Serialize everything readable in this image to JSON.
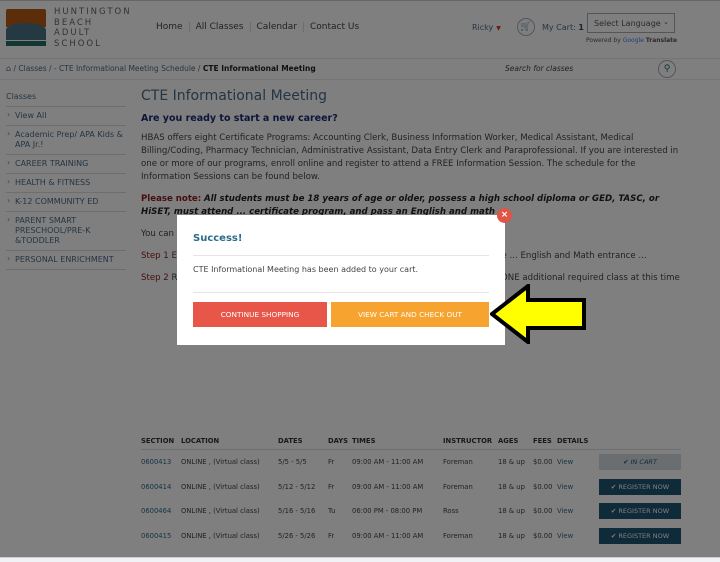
{
  "header": {
    "logo_text": [
      "HUNTINGTON",
      "BEACH",
      "ADULT",
      "SCHOOL"
    ],
    "nav": [
      "Home",
      "All Classes",
      "Calendar",
      "Contact Us"
    ],
    "user_name": "Ricky",
    "cart_label": "My Cart:",
    "cart_count": "1",
    "language_select": "Select Language",
    "powered_by": "Powered by",
    "google": "Google",
    "translate": "Translate"
  },
  "breadcrumb": {
    "items": [
      "/ Classes /",
      "- CTE Informational Meeting Schedule /"
    ],
    "current": "CTE Informational Meeting",
    "search_placeholder": "Search for classes"
  },
  "sidebar": {
    "title": "Classes",
    "items": [
      "View All",
      "Academic Prep/ APA Kids & APA Jr.!",
      "CAREER TRAINING",
      "HEALTH & FITNESS",
      "K-12 COMMUNITY ED",
      "PARENT SMART PRESCHOOL/PRE-K &TODDLER",
      "PERSONAL ENRICHMENT"
    ]
  },
  "main": {
    "title": "CTE Informational Meeting",
    "subtitle": "Are you ready to start a new career?",
    "intro": "HBAS offers eight Certificate Programs: Accounting Clerk, Business Information Worker, Medical Assistant, Medical Billing/Coding, Pharmacy Technician, Administrative Assistant, Data Entry Clerk and Paraprofessional. If you are interested in one or more of our programs, enroll online and register to attend a FREE Information Session. The schedule for the Information Sessions can be found below.",
    "note_label": "Please note:",
    "note_text": "All students must be 18 years of age or older, possess a high school diploma or GED, TASC, or HiSET, must attend ... certificate program, and pass an English and math ...",
    "you_can": "You can ... steps must be completed in the order listed below.",
    "step1_label": "Step 1",
    "step1_text": "E... At the Information Session you will learn about ... and more. The schedule ... English and Math entrance ...",
    "step2_label": "Step 2",
    "step2_text": "Register for the Career Readiness Class. You may also choose to register for ONE additional required class at this time"
  },
  "table": {
    "headers": [
      "SECTION",
      "LOCATION",
      "DATES",
      "DAYS",
      "TIMES",
      "INSTRUCTOR",
      "AGES",
      "FEES",
      "DETAILS"
    ],
    "rows": [
      {
        "section": "0600413",
        "location": "ONLINE , (Virtual class)",
        "dates": "5/5 - 5/5",
        "days": "Fr",
        "times": "09:00 AM - 11:00 AM",
        "instructor": "Foreman",
        "ages": "18 & up",
        "fees": "$0.00",
        "details": "View",
        "action": "✔ IN CART"
      },
      {
        "section": "0600414",
        "location": "ONLINE , (Virtual class)",
        "dates": "5/12 - 5/12",
        "days": "Fr",
        "times": "09:00 AM - 11:00 AM",
        "instructor": "Foreman",
        "ages": "18 & up",
        "fees": "$0.00",
        "details": "View",
        "action": "✔ REGISTER NOW"
      },
      {
        "section": "0600464",
        "location": "ONLINE , (Virtual class)",
        "dates": "5/16 - 5/16",
        "days": "Tu",
        "times": "06:00 PM - 08:00 PM",
        "instructor": "Ross",
        "ages": "18 & up",
        "fees": "$0.00",
        "details": "View",
        "action": "✔ REGISTER NOW"
      },
      {
        "section": "0600415",
        "location": "ONLINE , (Virtual class)",
        "dates": "5/26 - 5/26",
        "days": "Fr",
        "times": "09:00 AM - 11:00 AM",
        "instructor": "Foreman",
        "ages": "18 & up",
        "fees": "$0.00",
        "details": "View",
        "action": "✔ REGISTER NOW"
      }
    ]
  },
  "modal": {
    "title": "Success!",
    "message": "CTE Informational Meeting has been added to your cart.",
    "continue_label": "CONTINUE SHOPPING",
    "checkout_label": "VIEW CART AND CHECK OUT",
    "close_icon": "×"
  },
  "colors": {
    "continue": "#e8564a",
    "checkout": "#f7a330",
    "register": "#1e5570",
    "arrow": "#ffff00"
  }
}
